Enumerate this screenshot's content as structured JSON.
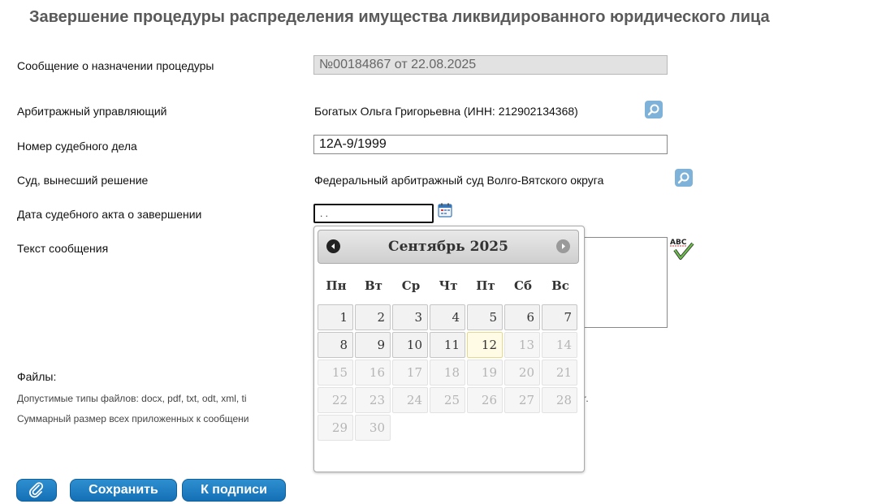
{
  "page_title": "Завершение процедуры распределения имущества ликвидированного юридического лица",
  "form": {
    "procedure_message": {
      "label": "Сообщение о назначении процедуры",
      "value": "№00184867 от 22.08.2025"
    },
    "arbitration_manager": {
      "label": "Арбитражный управляющий",
      "value": "Богатых Ольга Григорьевна (ИНН: 212902134368)"
    },
    "case_number": {
      "label": "Номер судебного дела",
      "value": "12А-9/1999"
    },
    "court": {
      "label": "Суд, вынесший решение",
      "value": "Федеральный арбитражный суд Волго-Вятского округа"
    },
    "completion_date": {
      "label": "Дата судебного акта о завершении",
      "value": ". ."
    },
    "message_text": {
      "label": "Текст сообщения",
      "value": ""
    }
  },
  "datepicker": {
    "title": "Сентябрь 2025",
    "weekdays": [
      "Пн",
      "Вт",
      "Ср",
      "Чт",
      "Пт",
      "Сб",
      "Вс"
    ],
    "today": 12,
    "first_weekday_index": 0,
    "days_in_month": 30,
    "last_enabled_day": 12
  },
  "files": {
    "heading": "Файлы:",
    "allowed_types": "Допустимые типы файлов: docx, pdf, txt, odt, xml, ti",
    "allowed_types_tail": "r.",
    "size_note": "Суммарный размер всех приложенных к сообщени"
  },
  "buttons": {
    "save": "Сохранить",
    "to_sign": "К подписи"
  },
  "colors": {
    "button": "#1f80c4",
    "search_button": "#7fb2d8",
    "today_highlight": "#fffbe5"
  }
}
